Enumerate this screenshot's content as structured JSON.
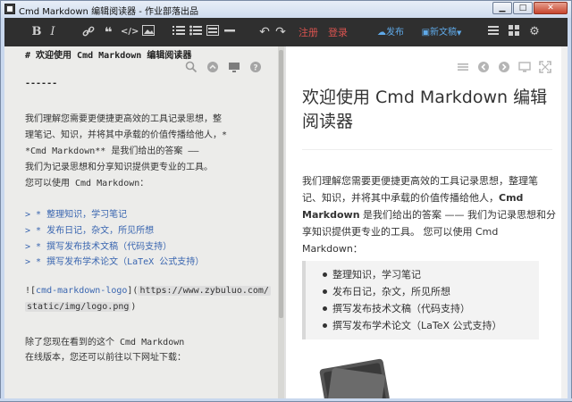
{
  "window": {
    "title": "Cmd Markdown 编辑阅读器 - 作业部落出品"
  },
  "toolbar": {
    "bold_label": "B",
    "italic_label": "I",
    "register_label": "注册",
    "login_label": "登录",
    "publish_label": "发布",
    "new_doc_label": "新文稿",
    "colors": {
      "background": "#2f2f2f",
      "icon": "#cfcfcf",
      "accent_red": "#d9534f",
      "accent_blue": "#5fa9e8"
    }
  },
  "editor": {
    "lines": [
      {
        "text": "# 欢迎使用 Cmd Markdown 编辑阅读器",
        "style": "bold"
      },
      {
        "text": "------",
        "style": "bold"
      },
      {
        "text": "我们理解您需要更便捷更高效的工具记录思想，整",
        "style": "normal"
      },
      {
        "text": "理笔记、知识，并将其中承载的价值传播给他人，*",
        "style": "normal"
      },
      {
        "text": "*Cmd Markdown** 是我们给出的答案 ——",
        "style": "normal"
      },
      {
        "text": "我们为记录思想和分享知识提供更专业的工具。",
        "style": "normal"
      },
      {
        "text": "您可以使用 Cmd Markdown：",
        "style": "normal"
      },
      {
        "text": "> * 整理知识，学习笔记",
        "style": "quote"
      },
      {
        "text": "> * 发布日记，杂文，所见所想",
        "style": "quote"
      },
      {
        "text": "> * 撰写发布技术文稿（代码支持）",
        "style": "quote"
      },
      {
        "text": "> * 撰写发布学术论文（LaTeX 公式支持）",
        "style": "quote"
      },
      {
        "text": "除了您现在看到的这个 Cmd Markdown",
        "style": "normal"
      },
      {
        "text": "在线版本，您还可以前往以下网址下载：",
        "style": "normal"
      }
    ],
    "image_line": {
      "prefix": "![",
      "alt": "cmd-markdown-logo",
      "mid": "](",
      "url_part1": "https://www.zybuluo.com/",
      "url_part2": "static/img/logo.png",
      "suffix": ")"
    }
  },
  "preview": {
    "title": "欢迎使用 Cmd Markdown 编辑阅读器",
    "paragraph_before": "我们理解您需要更便捷更高效的工具记录思想，整理笔记、知识，并将其中承载的价值传播给他人，",
    "paragraph_bold": "Cmd Markdown",
    "paragraph_after": " 是我们给出的答案 —— 我们为记录思想和分享知识提供更专业的工具。 您可以使用 Cmd Markdown：",
    "list": [
      "整理知识，学习笔记",
      "发布日记，杂文，所见所想",
      "撰写发布技术文稿（代码支持）",
      "撰写发布学术论文（LaTeX 公式支持）"
    ]
  }
}
